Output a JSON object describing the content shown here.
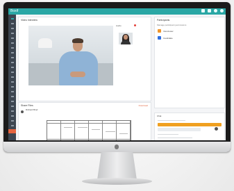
{
  "app": {
    "brand": "Boxif"
  },
  "video_panel": {
    "title": "Video Interview"
  },
  "pip": {
    "label": "Audio"
  },
  "participants": {
    "title": "Participants",
    "subtitle": "Manage participant permissions",
    "items": [
      {
        "name": "Interviewer",
        "color": "#f0962a"
      },
      {
        "name": "Candidate",
        "color": "#2f6fe0"
      }
    ]
  },
  "document": {
    "title": "Share Files",
    "action": "Download",
    "user": "Richard Brief"
  },
  "chat": {
    "title": "Chat"
  },
  "colors": {
    "accent": "#2aa7a5",
    "sidebar": "#3d4651",
    "active": "#e4643f"
  }
}
